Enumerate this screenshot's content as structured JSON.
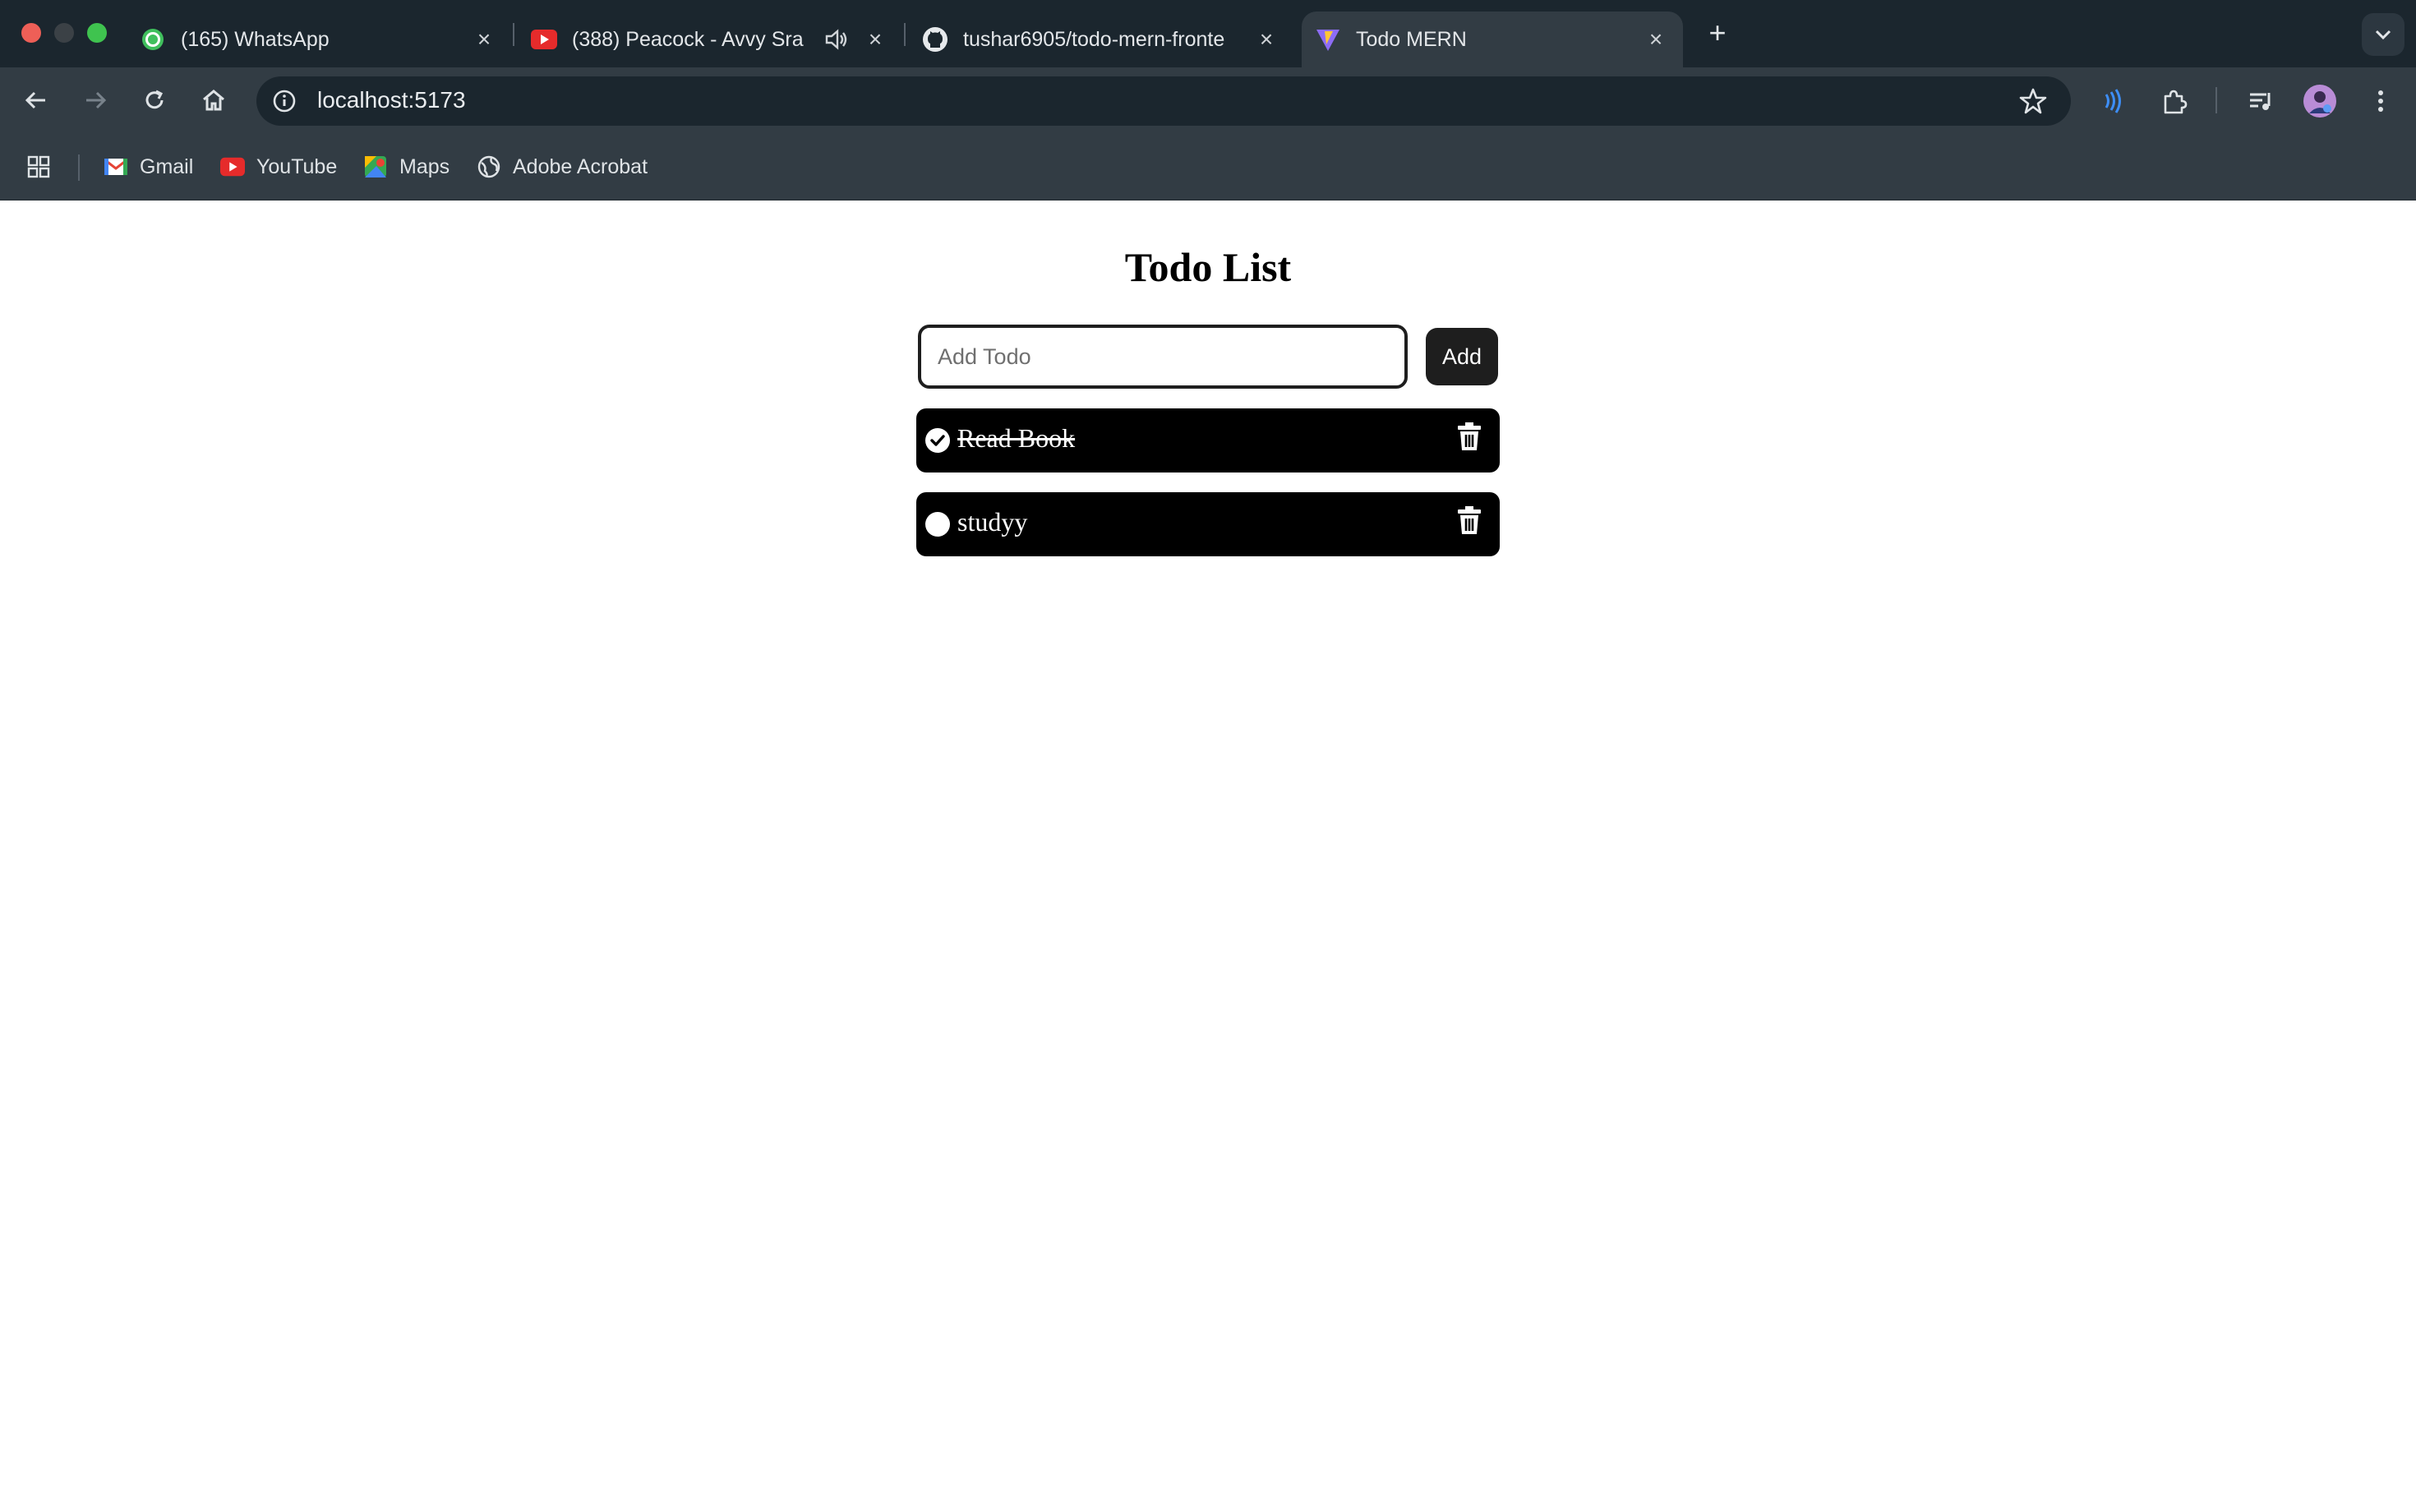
{
  "browser": {
    "tabs": [
      {
        "title": "(165) WhatsApp",
        "icon": "whatsapp-icon",
        "active": false
      },
      {
        "title": "(388) Peacock - Avvy Sra",
        "icon": "youtube-icon",
        "active": false,
        "audio": true
      },
      {
        "title": "tushar6905/todo-mern-fronte",
        "icon": "github-icon",
        "active": false
      },
      {
        "title": "Todo MERN",
        "icon": "vite-icon",
        "active": true
      }
    ],
    "url": "localhost:5173",
    "bookmarks": [
      {
        "label": "Gmail",
        "icon": "gmail-icon"
      },
      {
        "label": "YouTube",
        "icon": "youtube-icon"
      },
      {
        "label": "Maps",
        "icon": "maps-icon"
      },
      {
        "label": "Adobe Acrobat",
        "icon": "globe-icon"
      }
    ]
  },
  "app": {
    "title": "Todo List",
    "input": {
      "placeholder": "Add Todo",
      "value": ""
    },
    "add_label": "Add",
    "todos": [
      {
        "text": "Read Book",
        "done": true
      },
      {
        "text": "studyy",
        "done": false
      }
    ]
  },
  "colors": {
    "chrome_dark": "#1b262e",
    "chrome_toolbar": "#323c44",
    "todo_bg": "#000000",
    "button_bg": "#1e1e1e"
  }
}
